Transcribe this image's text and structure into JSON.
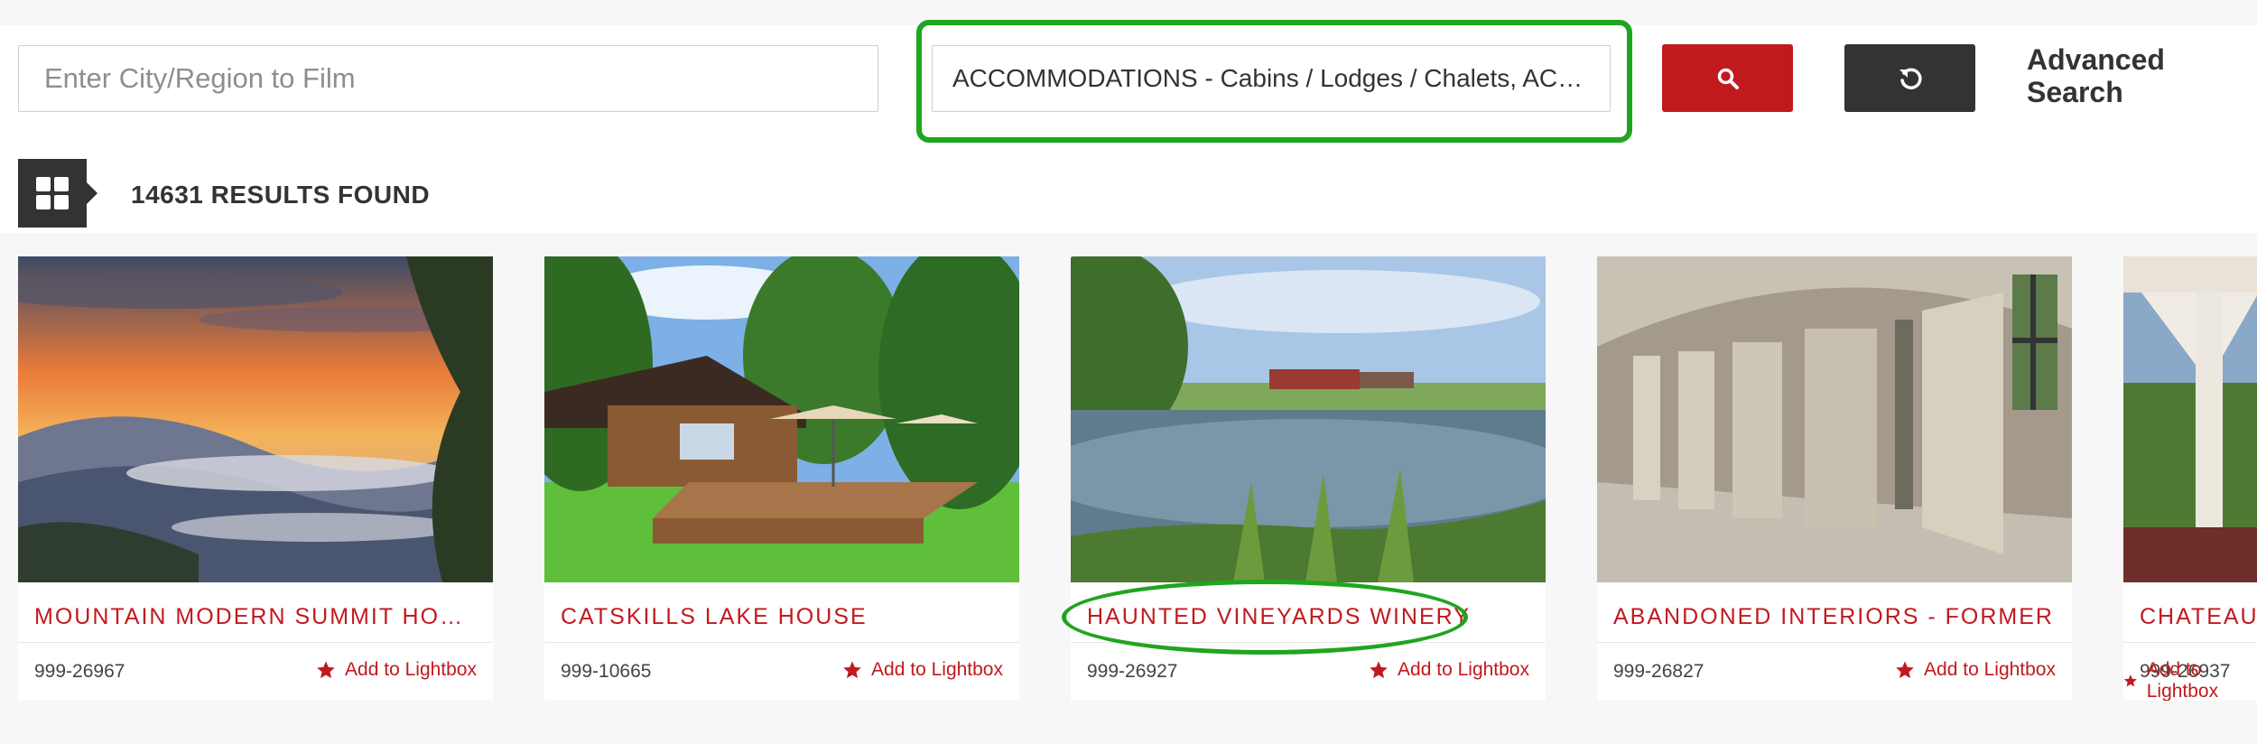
{
  "search": {
    "city_placeholder": "Enter City/Region to Film",
    "category_value": "ACCOMMODATIONS - Cabins / Lodges / Chalets, ACCOMMODATIONS",
    "search_button_icon": "search-icon",
    "reset_button_icon": "reset-icon",
    "advanced_label": "Advanced Search"
  },
  "results": {
    "count_label": "14631 RESULTS FOUND",
    "view_icon": "grid-icon"
  },
  "colors": {
    "accent": "#c1191e",
    "dark": "#333333",
    "highlight": "#1fa51f"
  },
  "cards": [
    {
      "title": "MOUNTAIN MODERN SUMMIT HOUSE",
      "ref": "999-26967",
      "lightbox": "Add to Lightbox"
    },
    {
      "title": "CATSKILLS LAKE HOUSE",
      "ref": "999-10665",
      "lightbox": "Add to Lightbox"
    },
    {
      "title": "HAUNTED VINEYARDS WINERY",
      "ref": "999-26927",
      "lightbox": "Add to Lightbox"
    },
    {
      "title": "ABANDONED INTERIORS - FORMER",
      "ref": "999-26827",
      "lightbox": "Add to Lightbox"
    },
    {
      "title": "CHATEAU",
      "ref": "999-26937",
      "lightbox": "Add to Lightbox"
    }
  ]
}
